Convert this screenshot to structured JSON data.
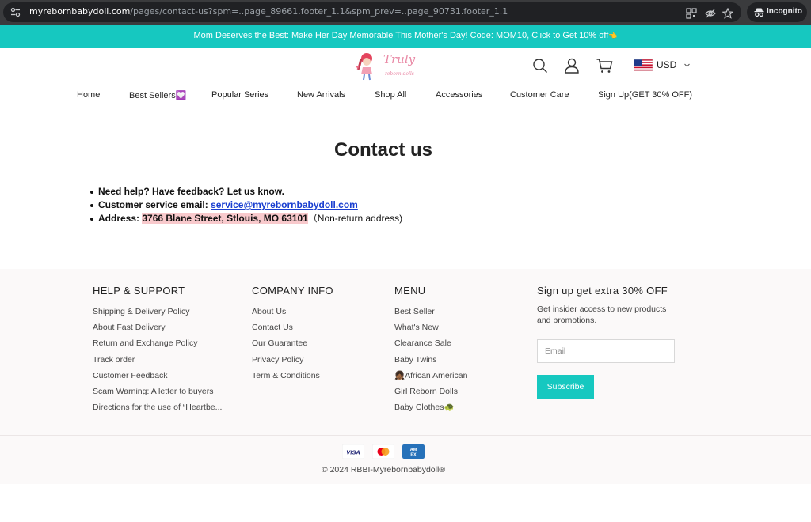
{
  "browser": {
    "url_host": "myrebornbabydoll.com",
    "url_path": "/pages/contact-us?spm=..page_89661.footer_1.1&spm_prev=..page_90731.footer_1.1",
    "mode_label": "Incognito"
  },
  "announcement": {
    "text": "Mom Deserves the Best: Make Her Day Memorable This Mother's Day! Code: MOM10, Click to Get 10% off",
    "emoji": "👈"
  },
  "header": {
    "logo_text": "Truly",
    "logo_subtext": "reborn dolls",
    "currency": "USD"
  },
  "nav": {
    "items": [
      "Home",
      "Best Sellers💟",
      "Popular Series",
      "New Arrivals",
      "Shop All",
      "Accessories",
      "Customer Care",
      "Sign Up(GET 30% OFF)"
    ]
  },
  "main": {
    "title": "Contact us",
    "line1": "Need help? Have feedback? Let us know.",
    "email_label": "Customer service email: ",
    "email": "service@myrebornbabydoll.com",
    "address_label": "Address: ",
    "address": "3766 Blane Street, Stlouis, MO 63101",
    "address_note": "（Non-return address)"
  },
  "footer": {
    "help": {
      "title": "HELP & SUPPORT",
      "links": [
        "Shipping & Delivery Policy",
        "About Fast Delivery",
        "Return and Exchange Policy",
        "Track order",
        "Customer Feedback",
        "Scam Warning: A letter to buyers",
        "Directions for the use of “Heartbe..."
      ]
    },
    "company": {
      "title": "COMPANY INFO",
      "links": [
        "About Us",
        "Contact Us",
        "Our Guarantee",
        "Privacy Policy",
        "Term & Conditions"
      ]
    },
    "menu": {
      "title": "MENU",
      "links": [
        "Best Seller",
        "What's New",
        "Clearance Sale",
        "Baby Twins",
        "👧🏾African American",
        "Girl Reborn Dolls",
        "Baby Clothes🐢"
      ]
    },
    "signup": {
      "title": "Sign up get extra 30% OFF",
      "description": "Get insider access to new products and promotions.",
      "email_placeholder": "Email",
      "button": "Subscribe"
    },
    "payments": [
      "VISA",
      "mastercard",
      "AMEX"
    ],
    "copyright": "© 2024 RBBI-Myrebornbabydoll®"
  },
  "colors": {
    "accent": "#16c8c0",
    "highlight": "#f8c9cc",
    "link": "#1a3fd0"
  }
}
